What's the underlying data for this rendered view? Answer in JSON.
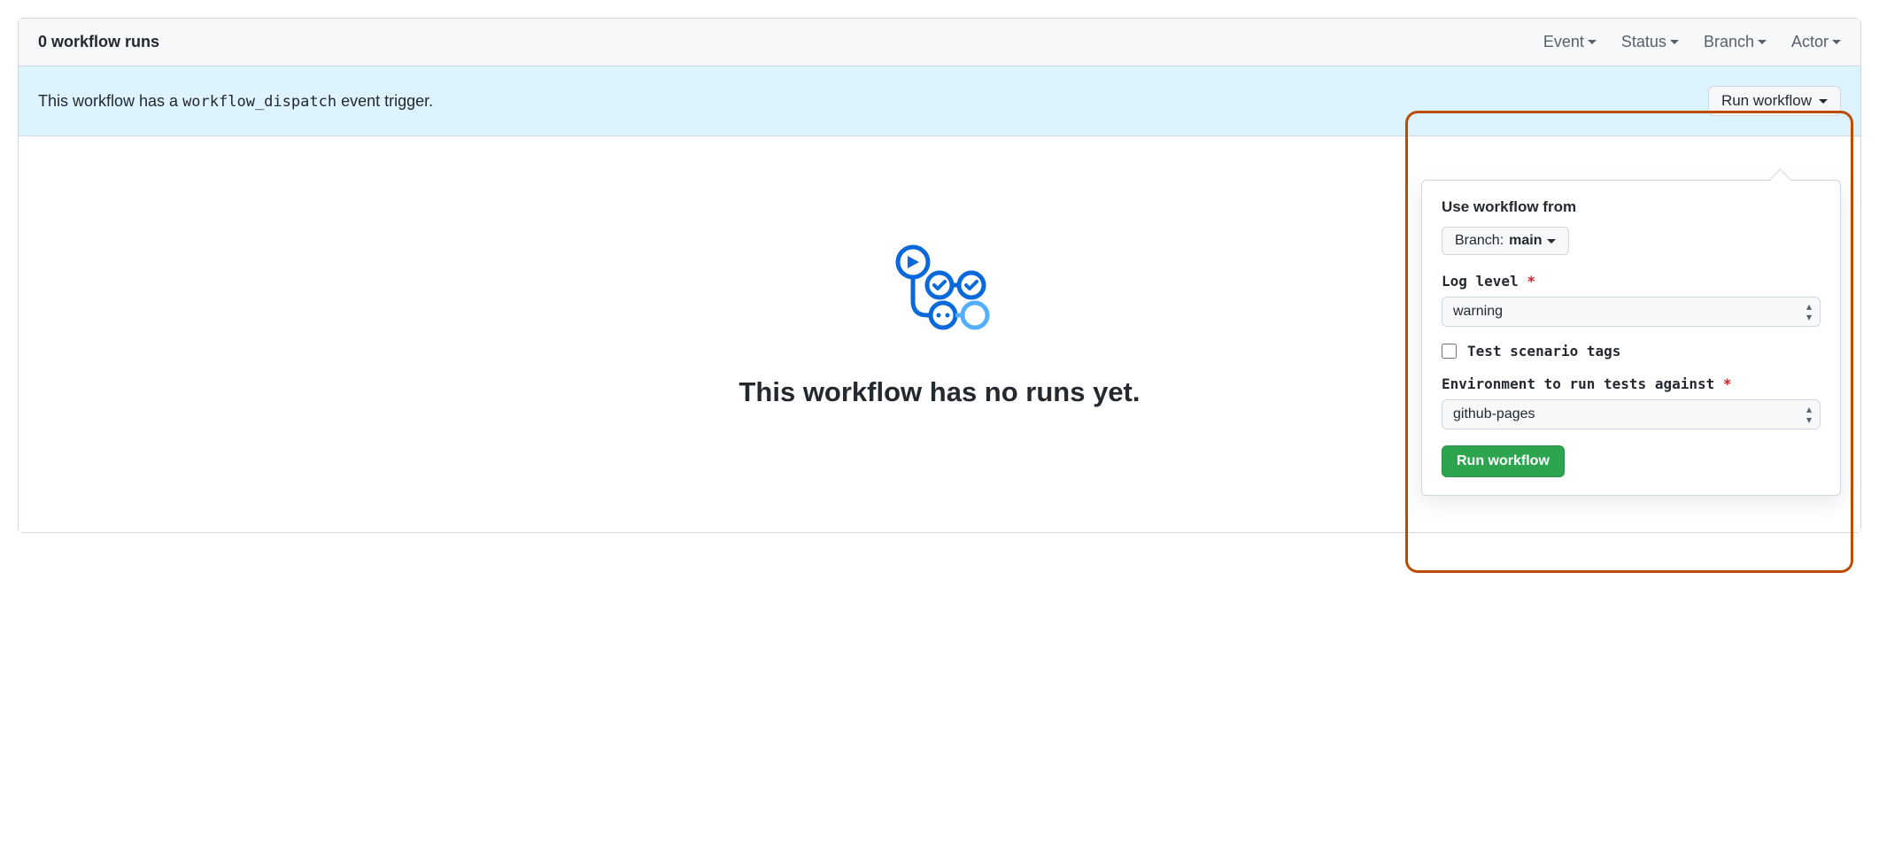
{
  "header": {
    "runs_label": "0 workflow runs",
    "filters": {
      "event": "Event",
      "status": "Status",
      "branch": "Branch",
      "actor": "Actor"
    }
  },
  "banner": {
    "text_prefix": "This workflow has a ",
    "code": "workflow_dispatch",
    "text_suffix": " event trigger.",
    "run_button": "Run workflow"
  },
  "empty": {
    "message": "This workflow has no runs yet."
  },
  "popover": {
    "use_from_label": "Use workflow from",
    "branch_prefix": "Branch: ",
    "branch_name": "main",
    "log_level_label": "Log level",
    "log_level_value": "warning",
    "checkbox_label": "Test scenario tags",
    "environment_label": "Environment to run tests against",
    "environment_value": "github-pages",
    "submit_label": "Run workflow"
  }
}
